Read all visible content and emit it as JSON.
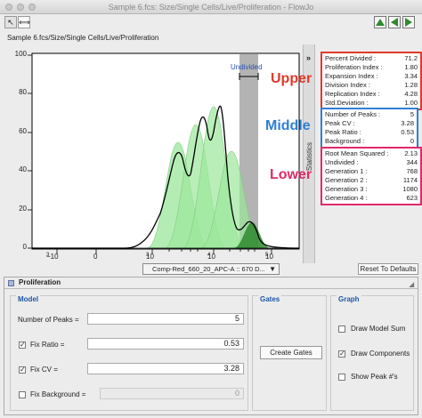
{
  "window": {
    "title": "Sample 6.fcs: Size/Single Cells/Live/Proliferation - FlowJo"
  },
  "toolbar": {
    "pointer_glyph": "↖",
    "range_glyph": "⟺"
  },
  "breadcrumb": "Sample 6.fcs/Size/Single Cells/Live/Proliferation",
  "plot": {
    "y_ticks": [
      "100",
      "80",
      "60",
      "40",
      "20",
      "0"
    ],
    "x_ticks": [
      "-10",
      "3",
      "0",
      "10",
      "3",
      "10",
      "4",
      "10",
      "5"
    ],
    "x_tick_labels": [
      {
        "base": "−10",
        "exp": "3"
      },
      {
        "base": "0",
        "exp": ""
      },
      {
        "base": "10",
        "exp": "3"
      },
      {
        "base": "10",
        "exp": "4"
      },
      {
        "base": "10",
        "exp": "5"
      }
    ],
    "undivided_label": "Undivided",
    "colors": {
      "curve": "#000000",
      "fill": "#9be79b",
      "fill_light": "#c9f2c6",
      "gate": "#b3b3b3",
      "label": "#2a4fb3"
    }
  },
  "side_strip_label": "Statistics",
  "collapse_glyph": "»",
  "annotations": {
    "upper": {
      "text": "Upper",
      "color": "#e03a2a"
    },
    "middle": {
      "text": "Middle",
      "color": "#2f7fd6"
    },
    "lower": {
      "text": "Lower",
      "color": "#e0296a"
    }
  },
  "stats_upper": [
    {
      "label": "Percent Divided :",
      "value": "71.2"
    },
    {
      "label": "Proliferation Index :",
      "value": "1.80"
    },
    {
      "label": "Expansion Index :",
      "value": "3.34"
    },
    {
      "label": "Division Index :",
      "value": "1.28"
    },
    {
      "label": "Replication Index :",
      "value": "4.28"
    },
    {
      "label": "Std.Deviation :",
      "value": "1.00"
    }
  ],
  "stats_middle": [
    {
      "label": "Number of Peaks :",
      "value": "5"
    },
    {
      "label": "Peak CV :",
      "value": "3.28"
    },
    {
      "label": "Peak Ratio :",
      "value": "0.53"
    },
    {
      "label": "Background :",
      "value": "0"
    }
  ],
  "stats_lower": [
    {
      "label": "Root Mean Squared :",
      "value": "2.13"
    },
    {
      "label": "Undivided :",
      "value": "344"
    },
    {
      "label": "Generation 1 :",
      "value": "768"
    },
    {
      "label": "Generation 2 :",
      "value": "1174"
    },
    {
      "label": "Generation 3 :",
      "value": "1080"
    },
    {
      "label": "Generation 4 :",
      "value": "623"
    }
  ],
  "parameter_select": "Comp-Red_660_20_APC-A :: 670 D...",
  "reset_button": "Reset To Defaults",
  "panel": {
    "title": "Proliferation",
    "model": {
      "title": "Model",
      "num_peaks_label": "Number of Peaks =",
      "num_peaks_value": "5",
      "fix_ratio_label": "Fix Ratio =",
      "fix_ratio_value": "0.53",
      "fix_cv_label": "Fix CV =",
      "fix_cv_value": "3.28",
      "fix_bg_label": "Fix Background =",
      "fix_bg_value": "0"
    },
    "gates": {
      "title": "Gates",
      "create_label": "Create Gates"
    },
    "graph": {
      "title": "Graph",
      "draw_model_sum": "Draw Model Sum",
      "draw_components": "Draw Components",
      "show_peaks": "Show Peak #'s"
    }
  }
}
